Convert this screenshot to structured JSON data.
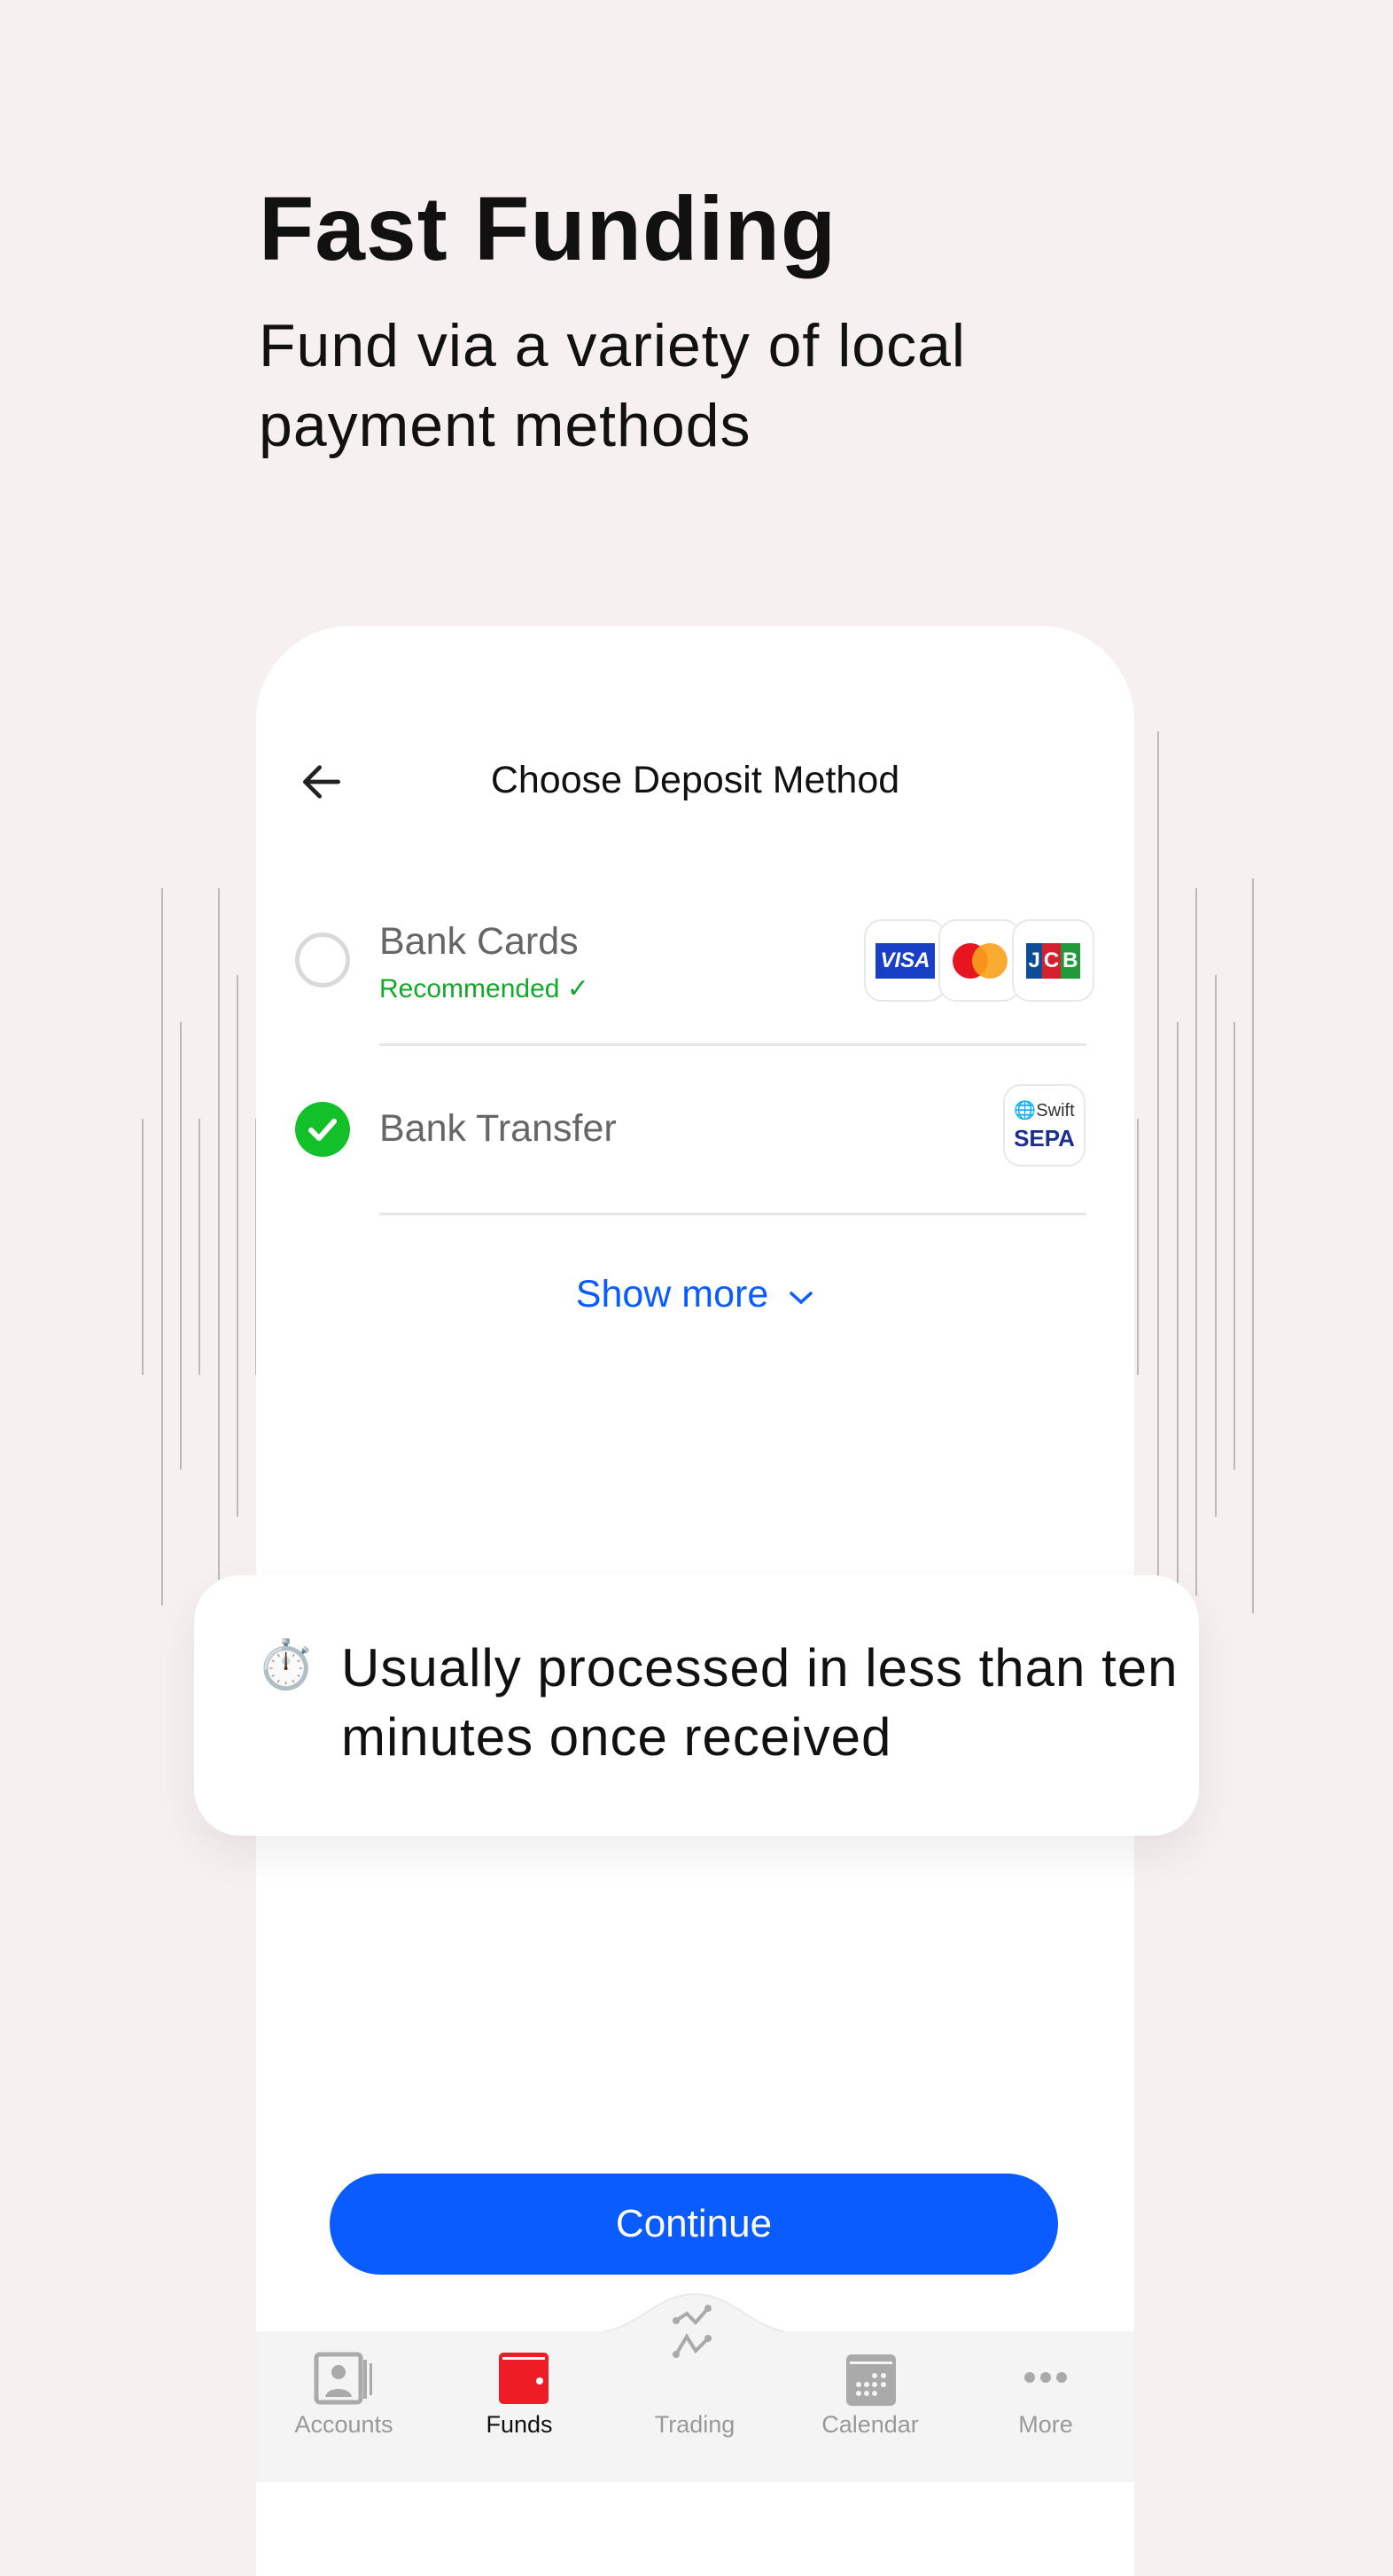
{
  "hero": {
    "title": "Fast Funding",
    "subtitle": "Fund via a variety of local payment methods"
  },
  "screen": {
    "header": {
      "title": "Choose Deposit Method",
      "back_icon": "arrow-left-icon"
    },
    "methods": [
      {
        "name": "Bank Cards",
        "tag": "Recommended ✓",
        "selected": false,
        "logos": [
          "VISA",
          "Mastercard",
          "JCB"
        ]
      },
      {
        "name": "Bank Transfer",
        "selected": true,
        "logos": [
          "Swift",
          "SEPA"
        ]
      }
    ],
    "show_more": "Show more",
    "continue": "Continue",
    "tabs": [
      {
        "label": "Accounts",
        "icon": "accounts-icon",
        "active": false
      },
      {
        "label": "Funds",
        "icon": "wallet-icon",
        "active": true
      },
      {
        "label": "Trading",
        "icon": "trading-chart-icon",
        "active": false
      },
      {
        "label": "Calendar",
        "icon": "calendar-icon",
        "active": false
      },
      {
        "label": "More",
        "icon": "more-dots-icon",
        "active": false
      }
    ]
  },
  "tooltip": {
    "icon": "stopwatch-icon",
    "emoji": "⏱️",
    "text": "Usually processed in less than ten minutes once received"
  },
  "logo_text": {
    "visa": "VISA",
    "jcb": "JCB",
    "swift": "Swift",
    "sepa": "SEPA"
  },
  "colors": {
    "accent": "#0a5cff",
    "success": "#12c12a",
    "active_tab": "#ee1c25",
    "background": "#f6f1f0"
  }
}
